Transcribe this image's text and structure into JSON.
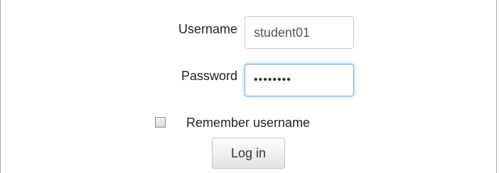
{
  "login_form": {
    "username_label": "Username",
    "username_value": "student01",
    "password_label": "Password",
    "password_value": "••••••••",
    "remember_label": "Remember username",
    "remember_checked": false,
    "login_button": "Log in"
  },
  "colors": {
    "focus_border": "#66afe9",
    "frame_border": "#a7a7a7"
  }
}
